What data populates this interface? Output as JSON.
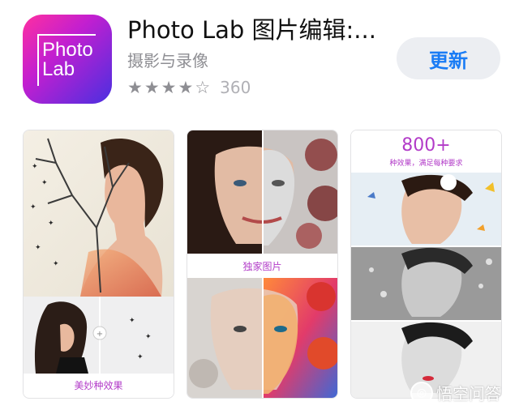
{
  "app": {
    "icon_text_line1": "Photo",
    "icon_text_line2": "Lab",
    "name": "Photo Lab 图片编辑:...",
    "category": "摄影与录像",
    "rating_count": "360",
    "stars": 4,
    "stars_max": 5,
    "action_label": "更新"
  },
  "screenshots": [
    {
      "caption": "美妙种效果"
    },
    {
      "caption": "独家图片"
    },
    {
      "badge_number": "800+",
      "badge_text": "种效果，满足每种要求"
    }
  ],
  "watermark": {
    "text": "悟空问答"
  },
  "colors": {
    "accent": "#1a7cf5",
    "button_bg": "#eceef2",
    "caption_purple": "#b23bc8",
    "star_gray": "#8e8e93"
  }
}
